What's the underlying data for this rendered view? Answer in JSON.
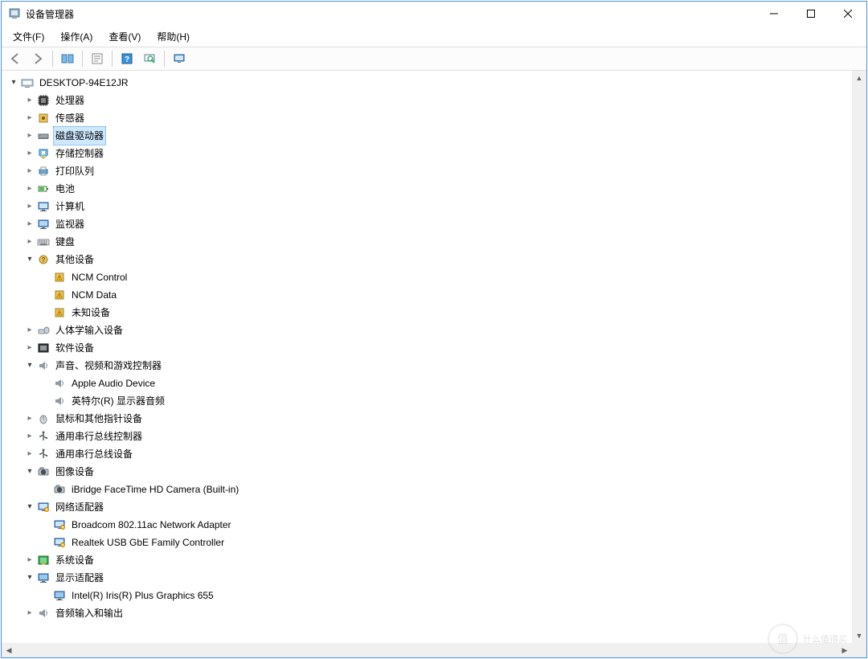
{
  "title": "设备管理器",
  "menus": {
    "file": "文件(F)",
    "action": "操作(A)",
    "view": "查看(V)",
    "help": "帮助(H)"
  },
  "root": "DESKTOP-94E12JR",
  "nodes": [
    {
      "label": "处理器",
      "icon": "cpu",
      "state": "closed",
      "depth": 1
    },
    {
      "label": "传感器",
      "icon": "sensor",
      "state": "closed",
      "depth": 1
    },
    {
      "label": "磁盘驱动器",
      "icon": "disk",
      "state": "closed",
      "depth": 1,
      "selected": true
    },
    {
      "label": "存储控制器",
      "icon": "storage",
      "state": "closed",
      "depth": 1
    },
    {
      "label": "打印队列",
      "icon": "printer",
      "state": "closed",
      "depth": 1
    },
    {
      "label": "电池",
      "icon": "battery",
      "state": "closed",
      "depth": 1
    },
    {
      "label": "计算机",
      "icon": "computer",
      "state": "closed",
      "depth": 1
    },
    {
      "label": "监视器",
      "icon": "monitor",
      "state": "closed",
      "depth": 1
    },
    {
      "label": "键盘",
      "icon": "keyboard",
      "state": "closed",
      "depth": 1
    },
    {
      "label": "其他设备",
      "icon": "other",
      "state": "open",
      "depth": 1
    },
    {
      "label": "NCM Control",
      "icon": "warn",
      "state": "none",
      "depth": 2
    },
    {
      "label": "NCM Data",
      "icon": "warn",
      "state": "none",
      "depth": 2
    },
    {
      "label": "未知设备",
      "icon": "warn",
      "state": "none",
      "depth": 2
    },
    {
      "label": "人体学输入设备",
      "icon": "hid",
      "state": "closed",
      "depth": 1
    },
    {
      "label": "软件设备",
      "icon": "software",
      "state": "closed",
      "depth": 1
    },
    {
      "label": "声音、视频和游戏控制器",
      "icon": "audio",
      "state": "open",
      "depth": 1
    },
    {
      "label": "Apple Audio Device",
      "icon": "audio",
      "state": "none",
      "depth": 2
    },
    {
      "label": "英特尔(R) 显示器音频",
      "icon": "audio",
      "state": "none",
      "depth": 2
    },
    {
      "label": "鼠标和其他指针设备",
      "icon": "mouse",
      "state": "closed",
      "depth": 1
    },
    {
      "label": "通用串行总线控制器",
      "icon": "usb",
      "state": "closed",
      "depth": 1
    },
    {
      "label": "通用串行总线设备",
      "icon": "usb",
      "state": "closed",
      "depth": 1
    },
    {
      "label": "图像设备",
      "icon": "camera",
      "state": "open",
      "depth": 1
    },
    {
      "label": "iBridge FaceTime HD Camera (Built-in)",
      "icon": "camera",
      "state": "none",
      "depth": 2
    },
    {
      "label": "网络适配器",
      "icon": "network",
      "state": "open",
      "depth": 1
    },
    {
      "label": "Broadcom 802.11ac Network Adapter",
      "icon": "network",
      "state": "none",
      "depth": 2
    },
    {
      "label": "Realtek USB GbE Family Controller",
      "icon": "network",
      "state": "none",
      "depth": 2
    },
    {
      "label": "系统设备",
      "icon": "system",
      "state": "closed",
      "depth": 1
    },
    {
      "label": "显示适配器",
      "icon": "display",
      "state": "open",
      "depth": 1
    },
    {
      "label": "Intel(R) Iris(R) Plus Graphics 655",
      "icon": "display",
      "state": "none",
      "depth": 2
    },
    {
      "label": "音频输入和输出",
      "icon": "audio",
      "state": "closed",
      "depth": 1
    }
  ],
  "watermark": "什么值得买"
}
